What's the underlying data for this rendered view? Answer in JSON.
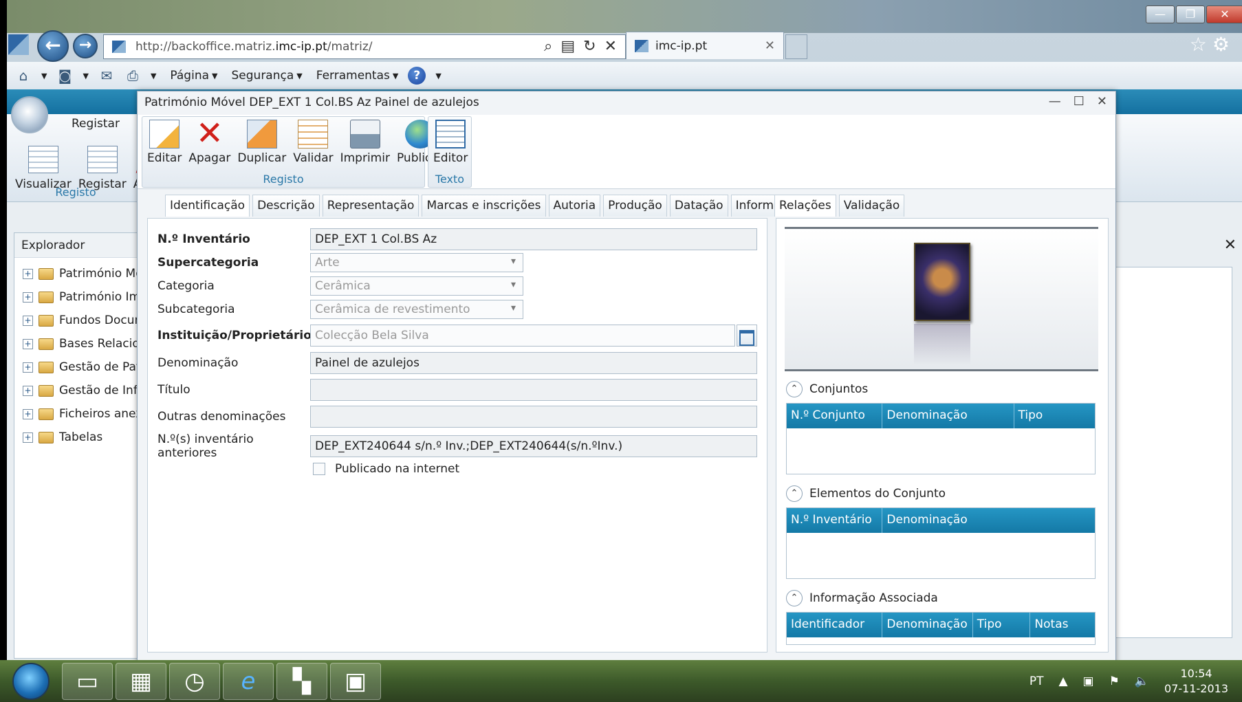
{
  "browser": {
    "url_prefix": "http://backoffice.matriz.",
    "url_host": "imc-ip.pt",
    "url_suffix": "/matriz/",
    "tab_title": "imc-ip.pt",
    "commands": [
      "Página",
      "Segurança",
      "Ferramentas"
    ]
  },
  "app": {
    "ribbon_tab": "Registar",
    "ribbon_buttons": [
      "Visualizar",
      "Registar",
      "Ap"
    ],
    "ribbon_group": "Registo",
    "explorer_title": "Explorador",
    "explorer_items": [
      "Património Móv",
      "Património Ima",
      "Fundos Docum",
      "Bases Relacion",
      "Gestão de Patr",
      "Gestão de Info",
      "Ficheiros anexo",
      "Tabelas"
    ]
  },
  "dialog": {
    "title": "Património Móvel DEP_EXT 1 Col.BS Az Painel de azulejos",
    "ribbon": {
      "registo_buttons": [
        "Editar",
        "Apagar",
        "Duplicar",
        "Validar",
        "Imprimir",
        "Publicar"
      ],
      "registo_label": "Registo",
      "texto_buttons": [
        "Editor"
      ],
      "texto_label": "Texto"
    },
    "tabs": [
      "Identificação",
      "Descrição",
      "Representação",
      "Marcas e inscrições",
      "Autoria",
      "Produção",
      "Datação",
      "Informa"
    ],
    "tabs_right": [
      "Relações",
      "Validação"
    ],
    "form": {
      "inventario": {
        "label": "N.º Inventário",
        "value": "DEP_EXT 1 Col.BS Az"
      },
      "supercategoria": {
        "label": "Supercategoria",
        "value": "Arte"
      },
      "categoria": {
        "label": "Categoria",
        "value": "Cerâmica"
      },
      "subcategoria": {
        "label": "Subcategoria",
        "value": "Cerâmica de revestimento"
      },
      "instituicao": {
        "label": "Instituição/Proprietário",
        "value": "Colecção Bela Silva"
      },
      "denominacao": {
        "label": "Denominação",
        "value": "Painel de azulejos"
      },
      "titulo": {
        "label": "Título",
        "value": ""
      },
      "outras": {
        "label": "Outras denominações",
        "value": ""
      },
      "anteriores": {
        "label": "N.º(s) inventário anteriores",
        "value": "DEP_EXT240644 s/n.º Inv.;DEP_EXT240644(s/n.ºInv.)"
      },
      "publicado": {
        "label": "Publicado na internet",
        "checked": false
      }
    },
    "relations": {
      "conjuntos": {
        "title": "Conjuntos",
        "columns": [
          "N.º Conjunto",
          "Denominação",
          "Tipo"
        ]
      },
      "elementos": {
        "title": "Elementos do Conjunto",
        "columns": [
          "N.º Inventário",
          "Denominação"
        ]
      },
      "informacao": {
        "title": "Informação Associada",
        "columns": [
          "Identificador",
          "Denominação",
          "Tipo",
          "Notas"
        ]
      }
    }
  },
  "taskbar": {
    "lang": "PT",
    "time": "10:54",
    "date": "07-11-2013"
  }
}
